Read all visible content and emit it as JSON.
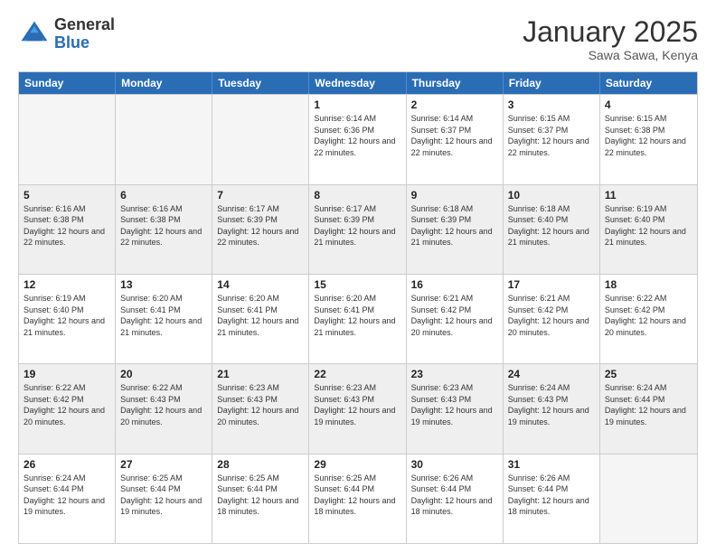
{
  "header": {
    "logo_general": "General",
    "logo_blue": "Blue",
    "month_year": "January 2025",
    "location": "Sawa Sawa, Kenya"
  },
  "days_of_week": [
    "Sunday",
    "Monday",
    "Tuesday",
    "Wednesday",
    "Thursday",
    "Friday",
    "Saturday"
  ],
  "weeks": [
    [
      {
        "day": "",
        "empty": true
      },
      {
        "day": "",
        "empty": true
      },
      {
        "day": "",
        "empty": true
      },
      {
        "day": "1",
        "sunrise": "6:14 AM",
        "sunset": "6:36 PM",
        "daylight": "12 hours and 22 minutes."
      },
      {
        "day": "2",
        "sunrise": "6:14 AM",
        "sunset": "6:37 PM",
        "daylight": "12 hours and 22 minutes."
      },
      {
        "day": "3",
        "sunrise": "6:15 AM",
        "sunset": "6:37 PM",
        "daylight": "12 hours and 22 minutes."
      },
      {
        "day": "4",
        "sunrise": "6:15 AM",
        "sunset": "6:38 PM",
        "daylight": "12 hours and 22 minutes."
      }
    ],
    [
      {
        "day": "5",
        "sunrise": "6:16 AM",
        "sunset": "6:38 PM",
        "daylight": "12 hours and 22 minutes."
      },
      {
        "day": "6",
        "sunrise": "6:16 AM",
        "sunset": "6:38 PM",
        "daylight": "12 hours and 22 minutes."
      },
      {
        "day": "7",
        "sunrise": "6:17 AM",
        "sunset": "6:39 PM",
        "daylight": "12 hours and 22 minutes."
      },
      {
        "day": "8",
        "sunrise": "6:17 AM",
        "sunset": "6:39 PM",
        "daylight": "12 hours and 21 minutes."
      },
      {
        "day": "9",
        "sunrise": "6:18 AM",
        "sunset": "6:39 PM",
        "daylight": "12 hours and 21 minutes."
      },
      {
        "day": "10",
        "sunrise": "6:18 AM",
        "sunset": "6:40 PM",
        "daylight": "12 hours and 21 minutes."
      },
      {
        "day": "11",
        "sunrise": "6:19 AM",
        "sunset": "6:40 PM",
        "daylight": "12 hours and 21 minutes."
      }
    ],
    [
      {
        "day": "12",
        "sunrise": "6:19 AM",
        "sunset": "6:40 PM",
        "daylight": "12 hours and 21 minutes."
      },
      {
        "day": "13",
        "sunrise": "6:20 AM",
        "sunset": "6:41 PM",
        "daylight": "12 hours and 21 minutes."
      },
      {
        "day": "14",
        "sunrise": "6:20 AM",
        "sunset": "6:41 PM",
        "daylight": "12 hours and 21 minutes."
      },
      {
        "day": "15",
        "sunrise": "6:20 AM",
        "sunset": "6:41 PM",
        "daylight": "12 hours and 21 minutes."
      },
      {
        "day": "16",
        "sunrise": "6:21 AM",
        "sunset": "6:42 PM",
        "daylight": "12 hours and 20 minutes."
      },
      {
        "day": "17",
        "sunrise": "6:21 AM",
        "sunset": "6:42 PM",
        "daylight": "12 hours and 20 minutes."
      },
      {
        "day": "18",
        "sunrise": "6:22 AM",
        "sunset": "6:42 PM",
        "daylight": "12 hours and 20 minutes."
      }
    ],
    [
      {
        "day": "19",
        "sunrise": "6:22 AM",
        "sunset": "6:42 PM",
        "daylight": "12 hours and 20 minutes."
      },
      {
        "day": "20",
        "sunrise": "6:22 AM",
        "sunset": "6:43 PM",
        "daylight": "12 hours and 20 minutes."
      },
      {
        "day": "21",
        "sunrise": "6:23 AM",
        "sunset": "6:43 PM",
        "daylight": "12 hours and 20 minutes."
      },
      {
        "day": "22",
        "sunrise": "6:23 AM",
        "sunset": "6:43 PM",
        "daylight": "12 hours and 19 minutes."
      },
      {
        "day": "23",
        "sunrise": "6:23 AM",
        "sunset": "6:43 PM",
        "daylight": "12 hours and 19 minutes."
      },
      {
        "day": "24",
        "sunrise": "6:24 AM",
        "sunset": "6:43 PM",
        "daylight": "12 hours and 19 minutes."
      },
      {
        "day": "25",
        "sunrise": "6:24 AM",
        "sunset": "6:44 PM",
        "daylight": "12 hours and 19 minutes."
      }
    ],
    [
      {
        "day": "26",
        "sunrise": "6:24 AM",
        "sunset": "6:44 PM",
        "daylight": "12 hours and 19 minutes."
      },
      {
        "day": "27",
        "sunrise": "6:25 AM",
        "sunset": "6:44 PM",
        "daylight": "12 hours and 19 minutes."
      },
      {
        "day": "28",
        "sunrise": "6:25 AM",
        "sunset": "6:44 PM",
        "daylight": "12 hours and 18 minutes."
      },
      {
        "day": "29",
        "sunrise": "6:25 AM",
        "sunset": "6:44 PM",
        "daylight": "12 hours and 18 minutes."
      },
      {
        "day": "30",
        "sunrise": "6:26 AM",
        "sunset": "6:44 PM",
        "daylight": "12 hours and 18 minutes."
      },
      {
        "day": "31",
        "sunrise": "6:26 AM",
        "sunset": "6:44 PM",
        "daylight": "12 hours and 18 minutes."
      },
      {
        "day": "",
        "empty": true
      }
    ]
  ]
}
